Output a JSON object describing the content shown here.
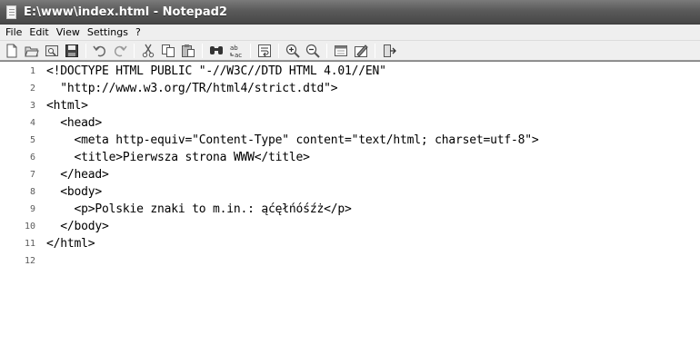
{
  "window": {
    "title": "E:\\www\\index.html - Notepad2"
  },
  "menu": {
    "items": [
      "File",
      "Edit",
      "View",
      "Settings",
      "?"
    ]
  },
  "toolbar": {
    "buttons": [
      "new-icon",
      "open-icon",
      "browse-icon",
      "save-icon",
      "undo-icon",
      "redo-icon",
      "cut-icon",
      "copy-icon",
      "paste-icon",
      "find-icon",
      "replace-icon",
      "wordwrap-icon",
      "zoom-in-icon",
      "zoom-out-icon",
      "view-icon",
      "scheme-icon",
      "exit-icon"
    ]
  },
  "editor": {
    "lines": [
      {
        "num": "1",
        "text": "<!DOCTYPE HTML PUBLIC \"-//W3C//DTD HTML 4.01//EN\""
      },
      {
        "num": "2",
        "text": "  \"http://www.w3.org/TR/html4/strict.dtd\">"
      },
      {
        "num": "3",
        "text": "<html>"
      },
      {
        "num": "4",
        "text": "  <head>"
      },
      {
        "num": "5",
        "text": "    <meta http-equiv=\"Content-Type\" content=\"text/html; charset=utf-8\">"
      },
      {
        "num": "6",
        "text": "    <title>Pierwsza strona WWW</title>"
      },
      {
        "num": "7",
        "text": "  </head>"
      },
      {
        "num": "8",
        "text": "  <body>"
      },
      {
        "num": "9",
        "text": "    <p>Polskie znaki to m.in.: ąćęłńóśźż</p>"
      },
      {
        "num": "10",
        "text": "  </body>"
      },
      {
        "num": "11",
        "text": "</html>"
      },
      {
        "num": "12",
        "text": ""
      }
    ]
  }
}
